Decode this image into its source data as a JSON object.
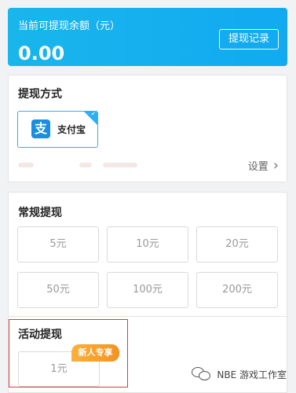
{
  "balance": {
    "label": "当前可提现余额（元）",
    "amount": "0.00",
    "history_button": "提现记录"
  },
  "method": {
    "title": "提现方式",
    "option": {
      "logo_glyph": "支",
      "label": "支付宝",
      "icon": "alipay-icon"
    },
    "settings_label": "设置",
    "settings_icon": "chevron-right-icon"
  },
  "regular": {
    "title": "常规提现",
    "amounts": [
      "5元",
      "10元",
      "20元",
      "50元",
      "100元",
      "200元"
    ]
  },
  "activity": {
    "title": "活动提现",
    "amount": "1元",
    "badge": "新人专享"
  },
  "watermark": {
    "text": "NBE 游戏工作室",
    "icon": "wechat-icon"
  },
  "colors": {
    "accent": "#16b0ef",
    "selected_border": "#2db0f3",
    "highlight_frame": "#e63434",
    "badge": "#f7a12e"
  }
}
